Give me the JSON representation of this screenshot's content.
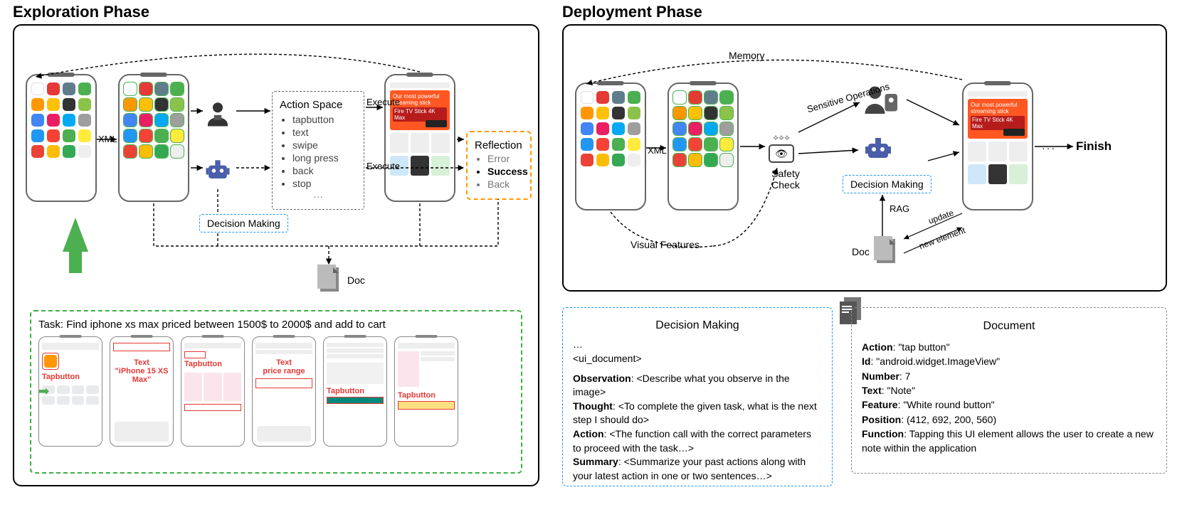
{
  "exploration": {
    "title": "Exploration Phase",
    "xml_label": "XML",
    "action_space": {
      "title": "Action Space",
      "items": [
        "tapbutton",
        "text",
        "swipe",
        "long press",
        "back",
        "stop"
      ],
      "more": "···"
    },
    "execute_label": "Execute",
    "reflection": {
      "title": "Reflection",
      "items": [
        "Error",
        "Success",
        "Back"
      ]
    },
    "decision_making_label": "Decision Making",
    "doc_label": "Doc"
  },
  "task": {
    "prefix": "Task:  ",
    "text": "Find iphone xs max priced between 1500$ to 2000$ and add to cart",
    "ann_tapbutton": "Tapbutton",
    "ann_text_iphone": "Text\n\"iPhone 15 XS Max\"",
    "ann_text_price": "Text\nprice range",
    "amazon_banner_title": "Our most powerful streaming stick",
    "amazon_banner_sub": "Fire TV Stick 4K Max"
  },
  "deployment": {
    "title": "Deployment Phase",
    "memory_label": "Memory",
    "xml_label": "XML",
    "visual_label": "Visual Features",
    "sensitive_label": "Sensitive Operations",
    "safety_label": "Safety Check",
    "decision_making_label": "Decision Making",
    "rag_label": "RAG",
    "doc_label": "Doc",
    "update_label": "update",
    "new_elem_label": "new element",
    "finish_label": "Finish",
    "dots": "···"
  },
  "dm_block": {
    "title": "Decision Making",
    "lines": [
      "…",
      "<ui_document>",
      "",
      "Observation: <Describe what you observe in the image>",
      "Thought: <To complete the given task, what is the next step I should do>",
      "Action: <The function call with the correct parameters to proceed with the task…>",
      "Summary: <Summarize your past actions along with your latest action in one or two sentences…>"
    ]
  },
  "doc_block": {
    "title": "Document",
    "action_k": "Action",
    "action_v": ": \"tap button\"",
    "id_k": "Id",
    "id_v": ": \"android.widget.ImageView\"",
    "number_k": "Number",
    "number_v": ": 7",
    "text_k": "Text",
    "text_v": ": \"Note\"",
    "feature_k": "Feature",
    "feature_v": ": \"White round button\"",
    "position_k": "Position",
    "position_v": ": (412, 692, 200, 560)",
    "function_k": "Function",
    "function_v": ": Tapping this UI element allows the user to create a new note within the application"
  }
}
